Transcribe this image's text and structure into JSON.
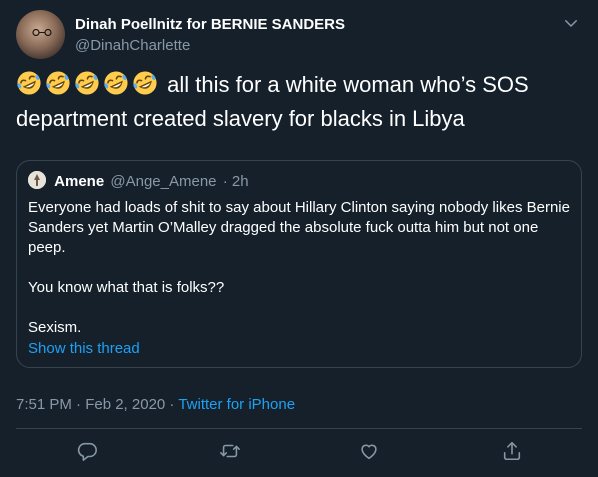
{
  "tweet": {
    "author": {
      "display_name": "Dinah Poellnitz for BERNIE SANDERS",
      "handle": "@DinahCharlette",
      "avatar_icon": "profile-photo"
    },
    "emoji": [
      "rolling-on-floor-laughing",
      "rolling-on-floor-laughing",
      "rolling-on-floor-laughing",
      "rolling-on-floor-laughing",
      "rolling-on-floor-laughing"
    ],
    "text": "all this for a white woman who’s SOS department created slavery for blacks in Libya",
    "quote": {
      "name": "Amene",
      "handle": "@Ange_Amene",
      "separator": "·",
      "age": "2h",
      "paragraphs": [
        "Everyone had loads of shit to say about Hillary Clinton saying nobody likes Bernie Sanders yet Martin O’Malley dragged the absolute fuck outta him but not one peep.",
        "You know what that is folks??",
        "Sexism."
      ],
      "show_thread": "Show this thread"
    },
    "timestamp": "7:51 PM · Feb 2, 2020 · ",
    "source": "Twitter for iPhone"
  },
  "colors": {
    "background": "#15202b",
    "text": "#ffffff",
    "secondary": "#8899a6",
    "link": "#1da1f2",
    "border": "#38444d"
  },
  "actions": [
    "reply-icon",
    "retweet-icon",
    "like-icon",
    "share-icon"
  ]
}
